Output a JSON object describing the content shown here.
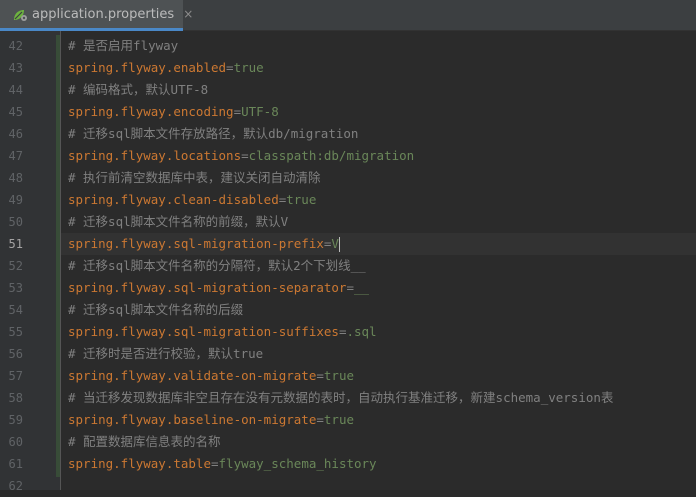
{
  "tab": {
    "label": "application.properties",
    "close": "×"
  },
  "gutter": {
    "line_numbers": [
      "42",
      "43",
      "44",
      "45",
      "46",
      "47",
      "48",
      "49",
      "50",
      "51",
      "52",
      "53",
      "54",
      "55",
      "56",
      "57",
      "58",
      "59",
      "60",
      "61",
      "62"
    ],
    "current_line": "51"
  },
  "code": {
    "lines": [
      {
        "type": "comment",
        "text": "# 是否启用flyway"
      },
      {
        "type": "prop",
        "key": "spring.flyway.enabled",
        "eq": "=",
        "value": "true"
      },
      {
        "type": "comment",
        "text": "# 编码格式，默认UTF-8"
      },
      {
        "type": "prop",
        "key": "spring.flyway.encoding",
        "eq": "=",
        "value": "UTF-8"
      },
      {
        "type": "comment",
        "text": "# 迁移sql脚本文件存放路径，默认db/migration"
      },
      {
        "type": "prop",
        "key": "spring.flyway.locations",
        "eq": "=",
        "value": "classpath:db/migration"
      },
      {
        "type": "comment",
        "text": "# 执行前清空数据库中表，建议关闭自动清除"
      },
      {
        "type": "prop",
        "key": "spring.flyway.clean-disabled",
        "eq": "=",
        "value": "true"
      },
      {
        "type": "comment",
        "text": "# 迁移sql脚本文件名称的前缀，默认V"
      },
      {
        "type": "prop",
        "key": "spring.flyway.sql-migration-prefix",
        "eq": "=",
        "value": "V"
      },
      {
        "type": "comment",
        "text": "# 迁移sql脚本文件名称的分隔符，默认2个下划线__"
      },
      {
        "type": "prop",
        "key": "spring.flyway.sql-migration-separator",
        "eq": "=",
        "value": "__"
      },
      {
        "type": "comment",
        "text": "# 迁移sql脚本文件名称的后缀"
      },
      {
        "type": "prop",
        "key": "spring.flyway.sql-migration-suffixes",
        "eq": "=",
        "value": ".sql"
      },
      {
        "type": "comment",
        "text": "# 迁移时是否进行校验，默认true"
      },
      {
        "type": "prop",
        "key": "spring.flyway.validate-on-migrate",
        "eq": "=",
        "value": "true"
      },
      {
        "type": "comment",
        "text": "# 当迁移发现数据库非空且存在没有元数据的表时，自动执行基准迁移，新建schema_version表"
      },
      {
        "type": "prop",
        "key": "spring.flyway.baseline-on-migrate",
        "eq": "=",
        "value": "true"
      },
      {
        "type": "comment",
        "text": "# 配置数据库信息表的名称"
      },
      {
        "type": "prop",
        "key": "spring.flyway.table",
        "eq": "=",
        "value": "flyway_schema_history"
      },
      {
        "type": "empty",
        "text": ""
      }
    ]
  },
  "colors": {
    "background": "#2b2b2b",
    "comment": "#808080",
    "key": "#cc7832",
    "value": "#6a8759",
    "line_number": "#606366",
    "tab_underline": "#4a88c7"
  },
  "icons": {
    "tab_file_icon": "spring-leaf-settings-icon"
  }
}
